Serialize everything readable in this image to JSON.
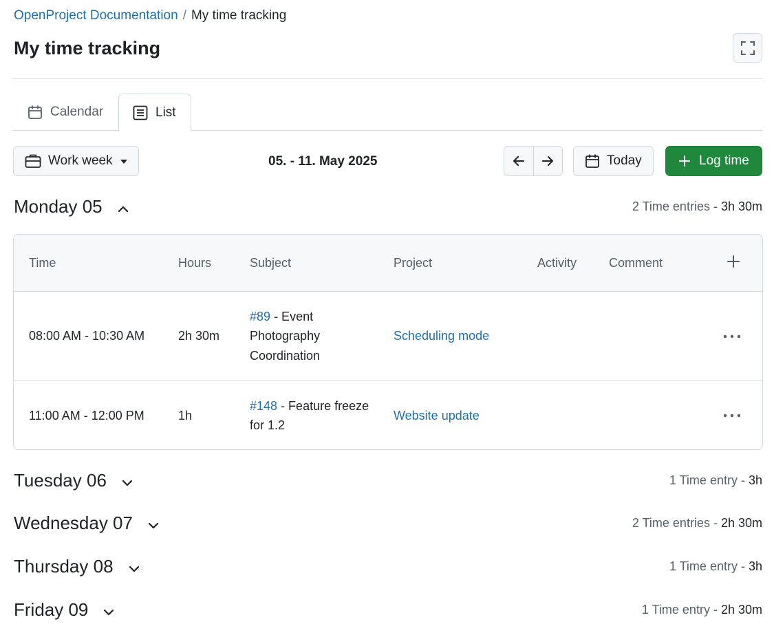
{
  "breadcrumb": {
    "root": "OpenProject Documentation",
    "separator": "/",
    "current": "My time tracking"
  },
  "page_title": "My time tracking",
  "tabs": [
    {
      "label": "Calendar",
      "icon": "calendar-icon",
      "active": false
    },
    {
      "label": "List",
      "icon": "list-icon",
      "active": true
    }
  ],
  "toolbar": {
    "range_select": "Work week",
    "date_range": "05. - 11. May 2025",
    "today_label": "Today",
    "log_time_label": "Log time"
  },
  "colors": {
    "primary": "#1f883d",
    "link": "#1f6fa8"
  },
  "days": [
    {
      "title": "Monday 05",
      "summary": "2 Time entries",
      "total": "3h 30m",
      "expanded": true
    },
    {
      "title": "Tuesday 06",
      "summary": "1 Time entry",
      "total": "3h",
      "expanded": false
    },
    {
      "title": "Wednesday 07",
      "summary": "2 Time entries",
      "total": "2h 30m",
      "expanded": false
    },
    {
      "title": "Thursday 08",
      "summary": "1 Time entry",
      "total": "3h",
      "expanded": false
    },
    {
      "title": "Friday 09",
      "summary": "1 Time entry",
      "total": "2h 30m",
      "expanded": false
    }
  ],
  "table": {
    "columns": [
      "Time",
      "Hours",
      "Subject",
      "Project",
      "Activity",
      "Comment"
    ],
    "rows": [
      {
        "time": "08:00 AM - 10:30 AM",
        "hours": "2h 30m",
        "wp_id": "#89",
        "wp_title": "- Event Photography Coordination",
        "project": "Scheduling mode",
        "activity": "",
        "comment": ""
      },
      {
        "time": "11:00 AM - 12:00 PM",
        "hours": "1h",
        "wp_id": "#148",
        "wp_title": "- Feature freeze for 1.2",
        "project": "Website update",
        "activity": "",
        "comment": ""
      }
    ]
  }
}
